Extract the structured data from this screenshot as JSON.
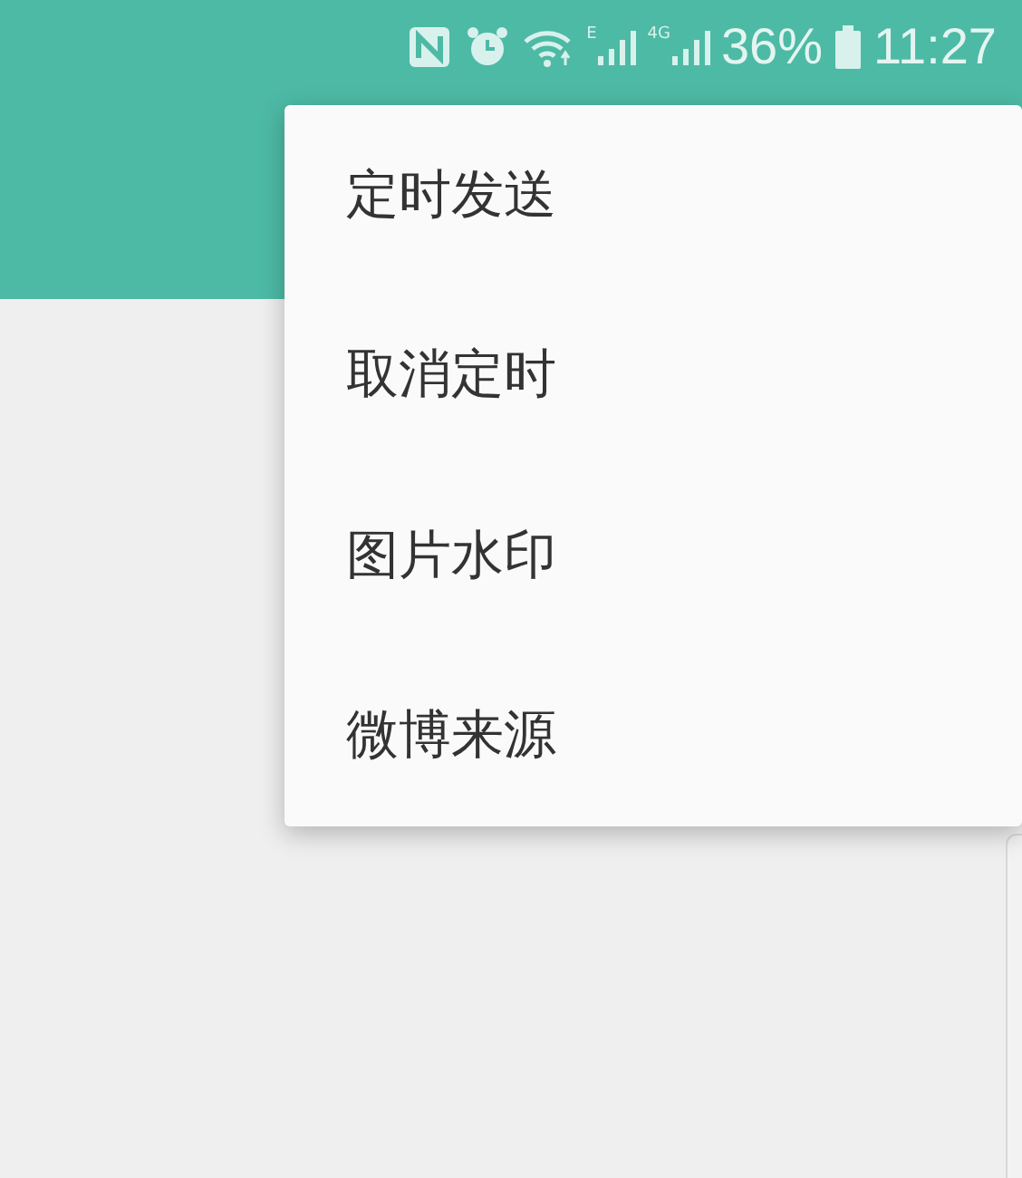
{
  "status_bar": {
    "network_labels": [
      "E",
      "4G"
    ],
    "battery": "36%",
    "time": "11:27"
  },
  "menu": {
    "items": [
      {
        "label": "定时发送"
      },
      {
        "label": "取消定时"
      },
      {
        "label": "图片水印"
      },
      {
        "label": "微博来源"
      }
    ]
  }
}
